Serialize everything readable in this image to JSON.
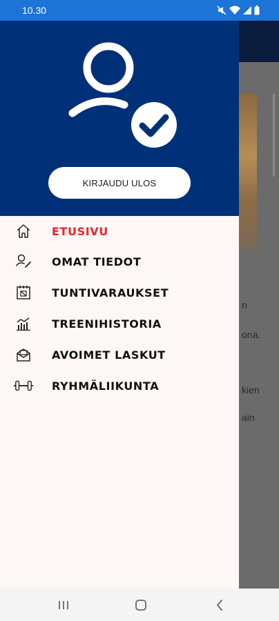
{
  "status_bar": {
    "time": "10.30",
    "icons": [
      "mute-icon",
      "wifi-icon",
      "signal-icon",
      "battery-icon"
    ]
  },
  "drawer": {
    "header": {
      "avatar_icon": "user-verified-icon",
      "logout_label": "KIRJAUDU ULOS"
    },
    "menu": [
      {
        "label": "ETUSIVU",
        "icon": "home-icon",
        "active": true
      },
      {
        "label": "OMAT TIEDOT",
        "icon": "user-edit-icon",
        "active": false
      },
      {
        "label": "TUNTIVARAUKSET",
        "icon": "calendar-icon",
        "active": false
      },
      {
        "label": "TREENIHISTORIA",
        "icon": "chart-icon",
        "active": false
      },
      {
        "label": "AVOIMET LASKUT",
        "icon": "mail-icon",
        "active": false
      },
      {
        "label": "RYHMÄLIIKUNTA",
        "icon": "dumbbell-icon",
        "active": false
      }
    ]
  },
  "background_app": {
    "text_fragments": [
      "n",
      "ona.",
      "kien",
      "ain"
    ]
  },
  "colors": {
    "status_bar": "#1b74d6",
    "drawer_header": "#003178",
    "active_item": "#e8242b",
    "drawer_bg": "#fdf7f6"
  },
  "nav_bar": {
    "buttons": [
      "recents-button",
      "home-button",
      "back-button"
    ]
  }
}
